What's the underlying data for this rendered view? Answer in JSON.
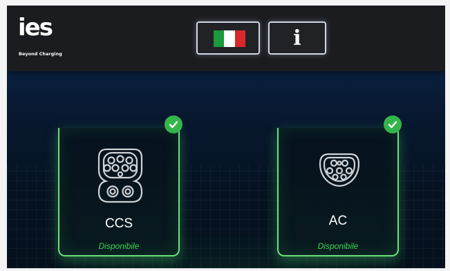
{
  "header": {
    "logo": {
      "mark": "ies",
      "tagline": "Beyond Charging"
    },
    "language_button": {
      "icon": "italian-flag-icon",
      "flag_colors": [
        "#1a9a3a",
        "#ffffff",
        "#d8282b"
      ]
    },
    "info_button": {
      "icon": "info-icon",
      "glyph": "i"
    }
  },
  "connectors": [
    {
      "title": "CCS",
      "status": "Disponibile",
      "icon": "ccs-connector-icon",
      "badge": "check-icon"
    },
    {
      "title": "AC",
      "status": "Disponibile",
      "icon": "type2-connector-icon",
      "badge": "check-icon"
    }
  ],
  "colors": {
    "accent_green": "#6de07e",
    "status_green": "#3fd45a",
    "badge_green": "#34b54a",
    "header_bg": "#1b1c1f",
    "background_blue": "#0b2a55"
  }
}
